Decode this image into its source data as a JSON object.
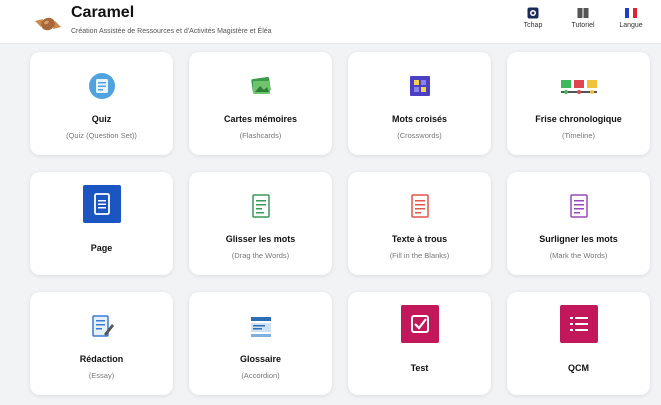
{
  "app": {
    "title": "Caramel",
    "subtitle": "Création Assistée de Ressources et d'Activités Magistère et Éléa"
  },
  "header_actions": [
    {
      "label": "Tchap",
      "icon": "tchap-icon"
    },
    {
      "label": "Tutoriel",
      "icon": "book-icon"
    },
    {
      "label": "Langue",
      "icon": "french-flag-icon"
    }
  ],
  "colors": {
    "accent": "#c2185b",
    "page_blue": "#1b55c2",
    "background": "#f2f3f5"
  },
  "cards": [
    {
      "name": "Quiz",
      "sub": "(Quiz (Question Set))",
      "icon": "quiz-icon"
    },
    {
      "name": "Cartes mémoires",
      "sub": "(Flashcards)",
      "icon": "flashcards-icon"
    },
    {
      "name": "Mots croisés",
      "sub": "(Crosswords)",
      "icon": "crossword-icon"
    },
    {
      "name": "Frise chronologique",
      "sub": "(Timeline)",
      "icon": "timeline-icon"
    },
    {
      "name": "Page",
      "sub": "",
      "icon": "page-icon"
    },
    {
      "name": "Glisser les mots",
      "sub": "(Drag the Words)",
      "icon": "drag-words-icon"
    },
    {
      "name": "Texte à trous",
      "sub": "(Fill in the Blanks)",
      "icon": "fill-blanks-icon"
    },
    {
      "name": "Surligner les mots",
      "sub": "(Mark the Words)",
      "icon": "mark-words-icon"
    },
    {
      "name": "Rédaction",
      "sub": "(Essay)",
      "icon": "essay-icon"
    },
    {
      "name": "Glossaire",
      "sub": "(Accordion)",
      "icon": "accordion-icon"
    },
    {
      "name": "Test",
      "sub": "",
      "icon": "test-checkbox-icon"
    },
    {
      "name": "QCM",
      "sub": "",
      "icon": "qcm-list-icon"
    }
  ]
}
